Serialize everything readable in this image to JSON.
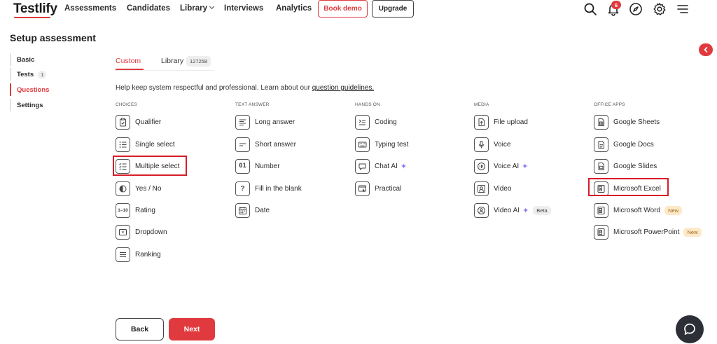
{
  "header": {
    "logo": "Testlify",
    "nav": {
      "assessments": "Assessments",
      "candidates": "Candidates",
      "library": "Library",
      "interviews": "Interviews",
      "analytics": "Analytics"
    },
    "book_demo": "Book demo",
    "upgrade": "Upgrade",
    "notification_count": "6",
    "icons": [
      "search-icon",
      "bell-icon",
      "compass-icon",
      "gear-icon",
      "menu-icon"
    ]
  },
  "page": {
    "title": "Setup assessment"
  },
  "steps": [
    {
      "label": "Basic",
      "count": ""
    },
    {
      "label": "Tests",
      "count": "1"
    },
    {
      "label": "Questions",
      "count": ""
    },
    {
      "label": "Settings",
      "count": ""
    }
  ],
  "tabs": {
    "custom": "Custom",
    "library": "Library",
    "library_count": "127258"
  },
  "help": {
    "text": "Help keep system respectful and professional. Learn about our",
    "link": "question guidelines."
  },
  "columns": {
    "choices": {
      "header": "CHOICES",
      "items": [
        "Qualifier",
        "Single select",
        "Multiple select",
        "Yes / No",
        "Rating",
        "Dropdown",
        "Ranking"
      ]
    },
    "text_answer": {
      "header": "TEXT ANSWER",
      "items": [
        "Long answer",
        "Short answer",
        "Number",
        "Fill in the blank",
        "Date"
      ]
    },
    "hands_on": {
      "header": "HANDS ON",
      "items": [
        "Coding",
        "Typing test",
        "Chat AI",
        "Practical"
      ]
    },
    "media": {
      "header": "MEDIA",
      "items": [
        "File upload",
        "Voice",
        "Voice AI",
        "Video",
        "Video AI"
      ],
      "beta": "Beta"
    },
    "office_apps": {
      "header": "OFFICE APPS",
      "items": [
        "Google Sheets",
        "Google Docs",
        "Google Slides",
        "Microsoft Excel",
        "Microsoft Word",
        "Microsoft PowerPoint"
      ],
      "new": "New"
    }
  },
  "footer": {
    "back": "Back",
    "next": "Next"
  },
  "colors": {
    "accent": "#e03a3e",
    "highlight": "#d71d2a",
    "ai_sparkle": "#8b7cf6"
  }
}
